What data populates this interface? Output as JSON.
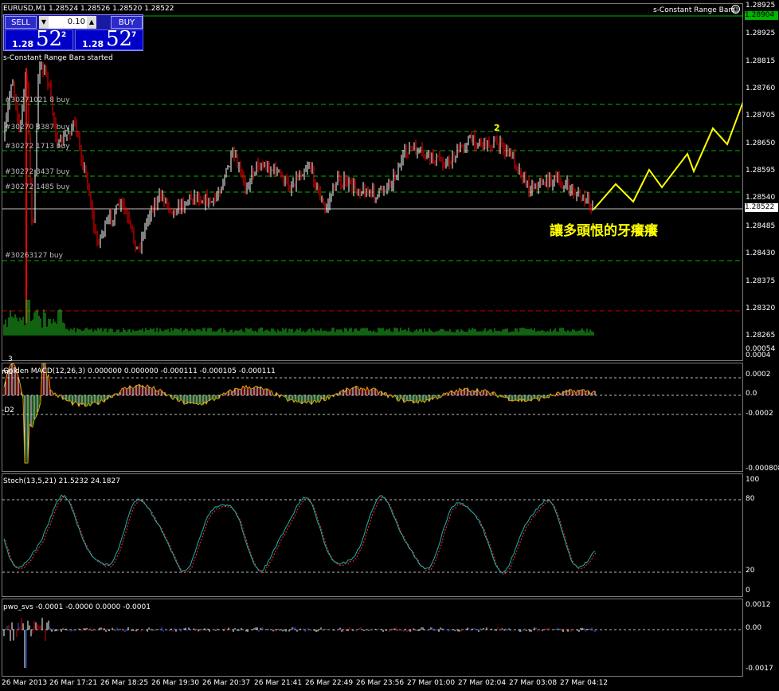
{
  "main": {
    "header": "EURUSD,M1  1.28524 1.28526 1.28520 1.28522",
    "indicator_name": "s-Constant Range Bars",
    "status_text": "s-Constant Range Bars started",
    "annotation": "讓多頭恨的牙癢癢",
    "wave_label": "2",
    "current_price": "1.28522",
    "top_price": "1.28904",
    "scale_ticks": [
      "1.28925",
      "1.28815",
      "1.28760",
      "1.28705",
      "1.28650",
      "1.28595",
      "1.28540",
      "1.28485",
      "1.28430",
      "1.28375",
      "1.28320",
      "1.28265"
    ],
    "orders": [
      {
        "label": "#30271021 8 buy"
      },
      {
        "label": "#30270 8387 buy"
      },
      {
        "label": "#30272 1713 buy"
      },
      {
        "label": "#30272 3437 buy"
      },
      {
        "label": "#30272 1485 buy"
      },
      {
        "label": "#30263127 buy"
      }
    ],
    "colors": {
      "bull": "#ffffff",
      "bear": "#ff0000",
      "grid": "#00b400",
      "volume": "#22c422",
      "bid_line": "#c0c0c0",
      "arrow": "#ffff00"
    }
  },
  "one_click": {
    "sell_label": "SELL",
    "buy_label": "BUY",
    "lot": "0.10",
    "sell_small": "1.28",
    "sell_big": "52",
    "sell_sup": "2",
    "buy_small": "1.28",
    "buy_big": "52",
    "buy_sup": "7"
  },
  "macd": {
    "header": "Golden MACD(12,26,3) 0.000000 0.000000 -0.000111 -0.000105 -0.000111",
    "levels": [
      "3",
      "m3",
      "-D2"
    ],
    "scale_ticks": [
      "0.00054",
      "0.0004",
      "0.0002",
      "0.0",
      "-0.0002",
      "-0.000808"
    ]
  },
  "stoch": {
    "header": "Stoch(13,5,21) 21.5232 24.1827",
    "scale_ticks": [
      "100",
      "80",
      "20",
      "0"
    ]
  },
  "pwo": {
    "header": "pwo_svs -0.0001 -0.0000 0.0000 -0.0001",
    "scale_ticks": [
      "0.0012",
      "0.00",
      "-0.0017"
    ]
  },
  "time_axis": [
    "26 Mar 2013",
    "26 Mar 17:21",
    "26 Mar 18:25",
    "26 Mar 19:30",
    "26 Mar 20:37",
    "26 Mar 21:41",
    "26 Mar 22:49",
    "26 Mar 23:56",
    "27 Mar 01:00",
    "27 Mar 02:04",
    "27 Mar 03:08",
    "27 Mar 04:12"
  ]
}
